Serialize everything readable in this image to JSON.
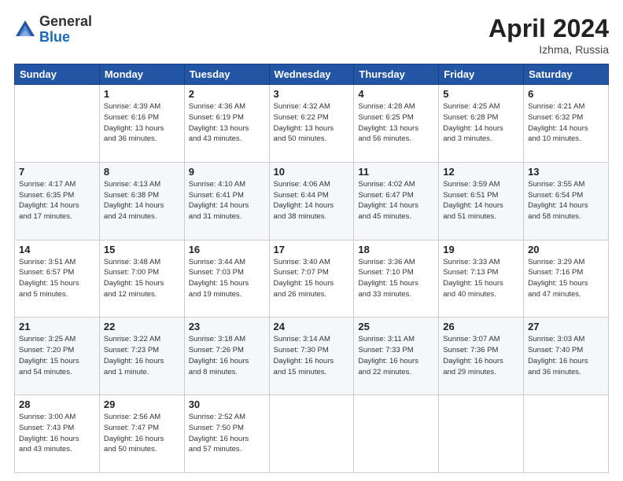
{
  "header": {
    "logo_general": "General",
    "logo_blue": "Blue",
    "month_title": "April 2024",
    "location": "Izhma, Russia"
  },
  "weekdays": [
    "Sunday",
    "Monday",
    "Tuesday",
    "Wednesday",
    "Thursday",
    "Friday",
    "Saturday"
  ],
  "weeks": [
    [
      {
        "num": "",
        "info": ""
      },
      {
        "num": "1",
        "info": "Sunrise: 4:39 AM\nSunset: 6:16 PM\nDaylight: 13 hours\nand 36 minutes."
      },
      {
        "num": "2",
        "info": "Sunrise: 4:36 AM\nSunset: 6:19 PM\nDaylight: 13 hours\nand 43 minutes."
      },
      {
        "num": "3",
        "info": "Sunrise: 4:32 AM\nSunset: 6:22 PM\nDaylight: 13 hours\nand 50 minutes."
      },
      {
        "num": "4",
        "info": "Sunrise: 4:28 AM\nSunset: 6:25 PM\nDaylight: 13 hours\nand 56 minutes."
      },
      {
        "num": "5",
        "info": "Sunrise: 4:25 AM\nSunset: 6:28 PM\nDaylight: 14 hours\nand 3 minutes."
      },
      {
        "num": "6",
        "info": "Sunrise: 4:21 AM\nSunset: 6:32 PM\nDaylight: 14 hours\nand 10 minutes."
      }
    ],
    [
      {
        "num": "7",
        "info": "Sunrise: 4:17 AM\nSunset: 6:35 PM\nDaylight: 14 hours\nand 17 minutes."
      },
      {
        "num": "8",
        "info": "Sunrise: 4:13 AM\nSunset: 6:38 PM\nDaylight: 14 hours\nand 24 minutes."
      },
      {
        "num": "9",
        "info": "Sunrise: 4:10 AM\nSunset: 6:41 PM\nDaylight: 14 hours\nand 31 minutes."
      },
      {
        "num": "10",
        "info": "Sunrise: 4:06 AM\nSunset: 6:44 PM\nDaylight: 14 hours\nand 38 minutes."
      },
      {
        "num": "11",
        "info": "Sunrise: 4:02 AM\nSunset: 6:47 PM\nDaylight: 14 hours\nand 45 minutes."
      },
      {
        "num": "12",
        "info": "Sunrise: 3:59 AM\nSunset: 6:51 PM\nDaylight: 14 hours\nand 51 minutes."
      },
      {
        "num": "13",
        "info": "Sunrise: 3:55 AM\nSunset: 6:54 PM\nDaylight: 14 hours\nand 58 minutes."
      }
    ],
    [
      {
        "num": "14",
        "info": "Sunrise: 3:51 AM\nSunset: 6:57 PM\nDaylight: 15 hours\nand 5 minutes."
      },
      {
        "num": "15",
        "info": "Sunrise: 3:48 AM\nSunset: 7:00 PM\nDaylight: 15 hours\nand 12 minutes."
      },
      {
        "num": "16",
        "info": "Sunrise: 3:44 AM\nSunset: 7:03 PM\nDaylight: 15 hours\nand 19 minutes."
      },
      {
        "num": "17",
        "info": "Sunrise: 3:40 AM\nSunset: 7:07 PM\nDaylight: 15 hours\nand 26 minutes."
      },
      {
        "num": "18",
        "info": "Sunrise: 3:36 AM\nSunset: 7:10 PM\nDaylight: 15 hours\nand 33 minutes."
      },
      {
        "num": "19",
        "info": "Sunrise: 3:33 AM\nSunset: 7:13 PM\nDaylight: 15 hours\nand 40 minutes."
      },
      {
        "num": "20",
        "info": "Sunrise: 3:29 AM\nSunset: 7:16 PM\nDaylight: 15 hours\nand 47 minutes."
      }
    ],
    [
      {
        "num": "21",
        "info": "Sunrise: 3:25 AM\nSunset: 7:20 PM\nDaylight: 15 hours\nand 54 minutes."
      },
      {
        "num": "22",
        "info": "Sunrise: 3:22 AM\nSunset: 7:23 PM\nDaylight: 16 hours\nand 1 minute."
      },
      {
        "num": "23",
        "info": "Sunrise: 3:18 AM\nSunset: 7:26 PM\nDaylight: 16 hours\nand 8 minutes."
      },
      {
        "num": "24",
        "info": "Sunrise: 3:14 AM\nSunset: 7:30 PM\nDaylight: 16 hours\nand 15 minutes."
      },
      {
        "num": "25",
        "info": "Sunrise: 3:11 AM\nSunset: 7:33 PM\nDaylight: 16 hours\nand 22 minutes."
      },
      {
        "num": "26",
        "info": "Sunrise: 3:07 AM\nSunset: 7:36 PM\nDaylight: 16 hours\nand 29 minutes."
      },
      {
        "num": "27",
        "info": "Sunrise: 3:03 AM\nSunset: 7:40 PM\nDaylight: 16 hours\nand 36 minutes."
      }
    ],
    [
      {
        "num": "28",
        "info": "Sunrise: 3:00 AM\nSunset: 7:43 PM\nDaylight: 16 hours\nand 43 minutes."
      },
      {
        "num": "29",
        "info": "Sunrise: 2:56 AM\nSunset: 7:47 PM\nDaylight: 16 hours\nand 50 minutes."
      },
      {
        "num": "30",
        "info": "Sunrise: 2:52 AM\nSunset: 7:50 PM\nDaylight: 16 hours\nand 57 minutes."
      },
      {
        "num": "",
        "info": ""
      },
      {
        "num": "",
        "info": ""
      },
      {
        "num": "",
        "info": ""
      },
      {
        "num": "",
        "info": ""
      }
    ]
  ]
}
